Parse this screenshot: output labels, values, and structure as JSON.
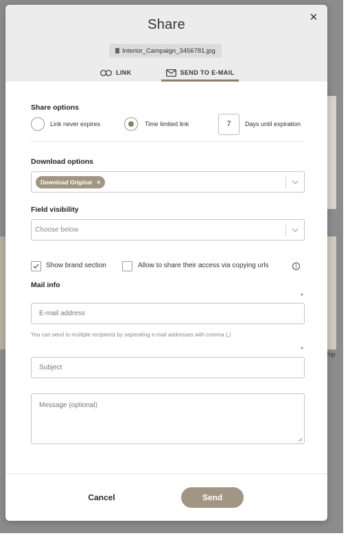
{
  "background": {
    "partial_text": "mp"
  },
  "dialog": {
    "title": "Share",
    "close_icon": "close-icon",
    "file_name": "Interior_Campaign_3456781.jpg",
    "tabs": [
      {
        "label": "LINK",
        "icon": "link-icon",
        "active": false
      },
      {
        "label": "SEND TO E-MAIL",
        "icon": "envelope-icon",
        "active": true
      }
    ]
  },
  "share_options": {
    "title": "Share options",
    "never_expires_label": "Link never expires",
    "time_limited_label": "Time limited link",
    "selected": "Time limited link",
    "days_value": "7",
    "days_label": "Days until expiration"
  },
  "download_options": {
    "title": "Download options",
    "selected_tag": "Download Original",
    "tag_remove": "×"
  },
  "field_visibility": {
    "title": "Field visibility",
    "placeholder": "Choose below"
  },
  "checkboxes": {
    "brand_label": "Show brand section",
    "brand_checked": true,
    "share_access_label": "Allow to share their access via copying urls",
    "share_access_checked": false,
    "info_glyph": "i"
  },
  "mail_info": {
    "title": "Mail info",
    "required_marker": "*",
    "email_placeholder": "E-mail address",
    "email_hint": "You can send to multiple recipients by seperating e-mail addresses with comma (,)",
    "subject_placeholder": "Subject",
    "message_placeholder": "Message (optional)"
  },
  "footer": {
    "cancel_label": "Cancel",
    "send_label": "Send"
  },
  "colors": {
    "accent": "#a29583",
    "tab_underline": "#8b7d6d",
    "header_bg": "#ececec"
  }
}
